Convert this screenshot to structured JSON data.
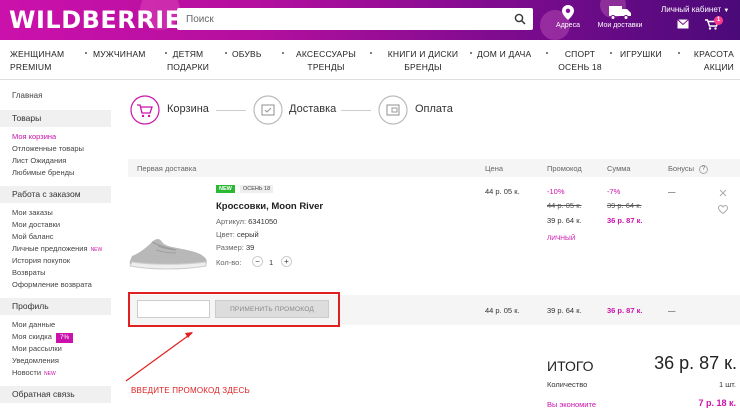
{
  "header": {
    "logo": "WILDBERRIES",
    "search_placeholder": "Поиск",
    "address_label": "Адреса",
    "delivery_label": "Мои доставки",
    "cabinet_label": "Личный кабинет",
    "cart_count": "1",
    "brand_color": "#cb11ab"
  },
  "nav": [
    {
      "l1": "ЖЕНЩИНАМ",
      "l2": "PREMIUM"
    },
    {
      "l1": "МУЖЧИНАМ",
      "l2": ""
    },
    {
      "l1": "ДЕТЯМ",
      "l2": "ПОДАРКИ"
    },
    {
      "l1": "ОБУВЬ",
      "l2": ""
    },
    {
      "l1": "АКСЕССУАРЫ",
      "l2": "ТРЕНДЫ"
    },
    {
      "l1": "КНИГИ И ДИСКИ",
      "l2": "БРЕНДЫ"
    },
    {
      "l1": "ДОМ И ДАЧА",
      "l2": ""
    },
    {
      "l1": "СПОРТ",
      "l2": "ОСЕНЬ 18"
    },
    {
      "l1": "ИГРУШКИ",
      "l2": ""
    },
    {
      "l1": "КРАСОТА",
      "l2": "АКЦИИ"
    }
  ],
  "sidebar": {
    "home": "Главная",
    "goods_title": "Товары",
    "goods": [
      "Моя корзина",
      "Отложенные товары",
      "Лист Ожидания",
      "Любимые бренды"
    ],
    "orders_title": "Работа с заказом",
    "orders": [
      "Мои заказы",
      "Мои доставки",
      "Мой баланс",
      "Личные предложения",
      "История покупок",
      "Возвраты",
      "Оформление возврата"
    ],
    "new_tag": "NEW",
    "profile_title": "Профиль",
    "profile": [
      "Мои данные",
      "Моя скидка",
      "Мои рассылки",
      "Уведомления",
      "Новости"
    ],
    "discount_pct": "7%",
    "feedback_title": "Обратная связь"
  },
  "steps": [
    "Корзина",
    "Доставка",
    "Оплата"
  ],
  "table": {
    "headers": {
      "first": "Первая доставка",
      "price": "Цена",
      "promo": "Промокод",
      "sum": "Сумма",
      "bonus": "Бонусы"
    },
    "bonus_help": "?"
  },
  "item": {
    "badge_new": "NEW",
    "badge_season": "ОСЕНЬ 18",
    "name": "Кроссовки, Moon River",
    "article_label": "Артикул:",
    "article": "6341050",
    "color_label": "Цвет:",
    "color": "серый",
    "size_label": "Размер:",
    "size": "39",
    "qty_label": "Кол-во:",
    "qty": "1",
    "minus": "−",
    "plus": "+",
    "price": "44 р. 05 к.",
    "promo_pct": "-10%",
    "promo_old": "44 р. 05 к.",
    "promo_new": "39 р. 64 к.",
    "promo_personal": "ЛИЧНЫЙ",
    "sum_pct": "-7%",
    "sum_old": "39 р. 64 к.",
    "sum_new": "36 р. 87 к.",
    "bonus": "—"
  },
  "promo_row": {
    "button": "ПРИМЕНИТЬ ПРОМОКОД",
    "price": "44 р. 05 к.",
    "promo": "39 р. 64 к.",
    "sum": "36 р. 87 к.",
    "bonus": "—"
  },
  "summary": {
    "total_label": "ИТОГО",
    "total": "36 р. 87 к.",
    "qty_label": "Количество",
    "qty": "1 шт.",
    "save_label": "Вы экономите",
    "save": "7 р. 18 к."
  },
  "annotation": "ВВЕДИТЕ ПРОМОКОД ЗДЕСЬ"
}
